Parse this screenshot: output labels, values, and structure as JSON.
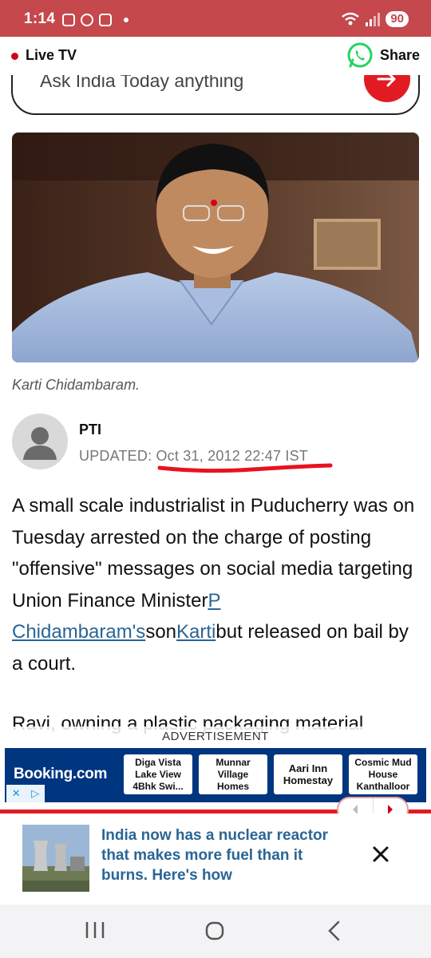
{
  "status_bar": {
    "time": "1:14",
    "battery": "90"
  },
  "top_nav": {
    "live_label": "Live TV",
    "share_label": "Share"
  },
  "search": {
    "placeholder": "Ask India Today anything"
  },
  "image_caption": "Karti Chidambaram.",
  "byline": {
    "author": "PTI",
    "updated_prefix": "UPDATED: ",
    "updated_value": "Oct 31, 2012 22:47 IST"
  },
  "article": {
    "p1_part1": "A small scale industrialist in Puducherry was on Tuesday arrested on the charge of posting \"offensive\" messages on social media targeting Union Finance Minister",
    "p1_link1": "P Chidambaram's",
    "p1_part2": "son",
    "p1_link2": "Karti",
    "p1_part3": "but released on bail by a court.",
    "p2": "Ravi, owning a plastic packaging material"
  },
  "advertisement": {
    "label": "ADVERTISEMENT",
    "brand": "Booking.com",
    "cards": [
      {
        "name": "Diga Vista Lake View 4Bhk Swi..."
      },
      {
        "name": "Munnar Village Homes"
      },
      {
        "name": "Aari Inn Homestay"
      },
      {
        "name": "Cosmic Mud House Kanthalloor"
      }
    ],
    "close_glyph": "✕",
    "adchoices_glyph": "▷"
  },
  "recommended_story": {
    "headline": "India now has a nuclear reactor that makes more fuel than it burns. Here's how"
  },
  "colors": {
    "brand_red": "#e21b23",
    "status_red": "#c5484c",
    "link_blue": "#2a6595",
    "booking_blue": "#003580"
  }
}
